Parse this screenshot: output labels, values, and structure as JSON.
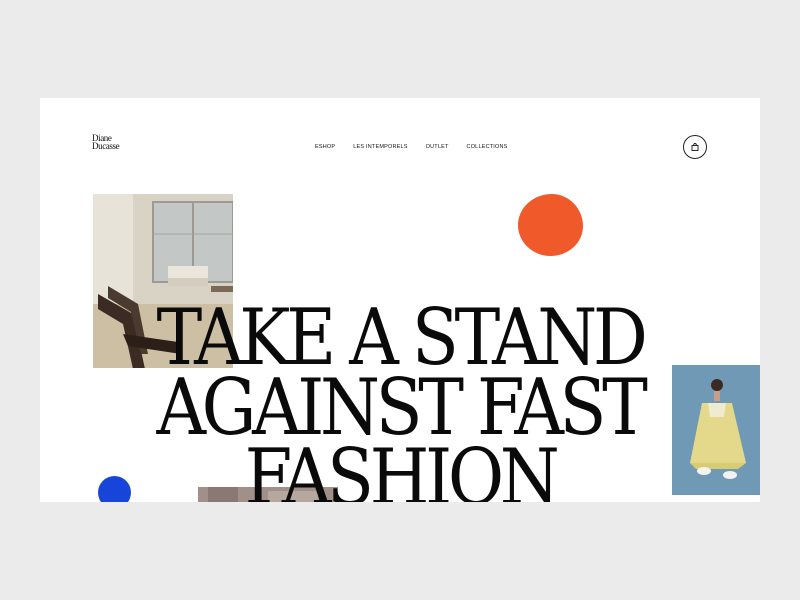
{
  "brand": {
    "line1": "Diane",
    "line2": "Ducasse"
  },
  "nav": {
    "items": [
      {
        "label": "ESHOP"
      },
      {
        "label": "LES INTEMPORELS"
      },
      {
        "label": "OUTLET"
      },
      {
        "label": "COLLECTIONS"
      }
    ]
  },
  "cart": {
    "icon": "bag-icon"
  },
  "hero": {
    "headline": "TAKE A STAND\nAGAINST FAST\nFASHION"
  },
  "colors": {
    "accent_orange": "#f05a2a",
    "accent_blue": "#1745d9"
  }
}
